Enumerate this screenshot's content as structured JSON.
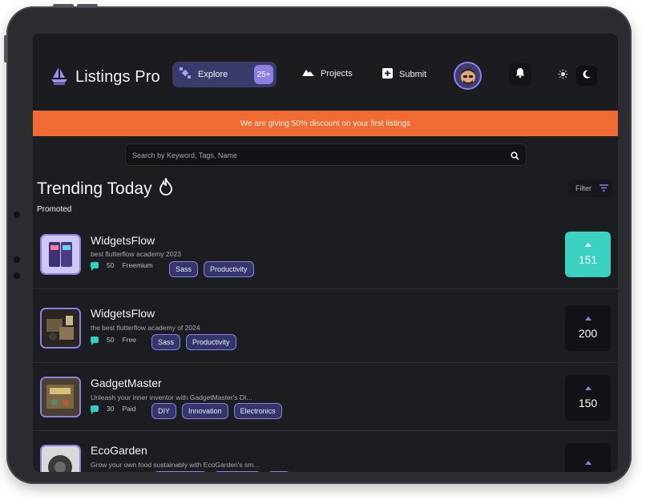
{
  "header": {
    "logo_text": "Listings Pro",
    "explore_label": "Explore",
    "explore_badge": "25+",
    "nav": [
      {
        "label": "Projects",
        "icon": "mountain-icon"
      },
      {
        "label": "Submit",
        "icon": "plus-square-icon"
      }
    ]
  },
  "promo_text": "We are giving 50% discount on your first listings",
  "search": {
    "placeholder": "Search by Keyword, Tags, Name"
  },
  "section": {
    "title": "Trending Today",
    "filter_label": "Filter",
    "subtitle": "Promoted"
  },
  "listings": [
    {
      "name": "WidgetsFlow",
      "description": "best flutterflow academy 2023",
      "comments": "50",
      "pricing": "Freemium",
      "tags": [
        "Sass",
        "Productivity"
      ],
      "votes": "151",
      "active": true
    },
    {
      "name": "WidgetsFlow",
      "description": "the best flutterflow academy of 2024",
      "comments": "50",
      "pricing": "Free",
      "tags": [
        "Sass",
        "Productivity"
      ],
      "votes": "200",
      "active": false
    },
    {
      "name": "GadgetMaster",
      "description": "Unleash your inner inventor with GadgetMaster's DI...",
      "comments": "30",
      "pricing": "Paid",
      "tags": [
        "DIY",
        "Innovation",
        "Electronics"
      ],
      "votes": "150",
      "active": false
    },
    {
      "name": "EcoGarden",
      "description": "Grow your own food sustainably with EcoGarden's sm...",
      "comments": "",
      "pricing": "",
      "tags": [],
      "votes": "",
      "active": false
    }
  ],
  "colors": {
    "accent": "#8b7fe3",
    "promo": "#f06b33",
    "vote_active": "#3bd1c0",
    "background": "#1c1d21"
  }
}
